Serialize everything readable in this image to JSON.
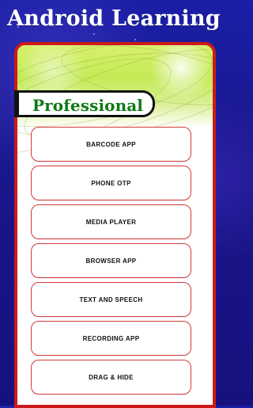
{
  "app": {
    "title": "Android Learning"
  },
  "section": {
    "title": "Professional"
  },
  "menu": {
    "items": [
      {
        "label": "BARCODE APP"
      },
      {
        "label": "PHONE OTP"
      },
      {
        "label": "MEDIA PLAYER"
      },
      {
        "label": "BROWSER APP"
      },
      {
        "label": "TEXT AND SPEECH"
      },
      {
        "label": "RECORDING APP"
      },
      {
        "label": "DRAG & HIDE"
      }
    ]
  },
  "colors": {
    "background": "#1a168c",
    "panel_border": "#cc1a1a",
    "section_text": "#0f7a16",
    "button_border": "#d43b3b"
  }
}
